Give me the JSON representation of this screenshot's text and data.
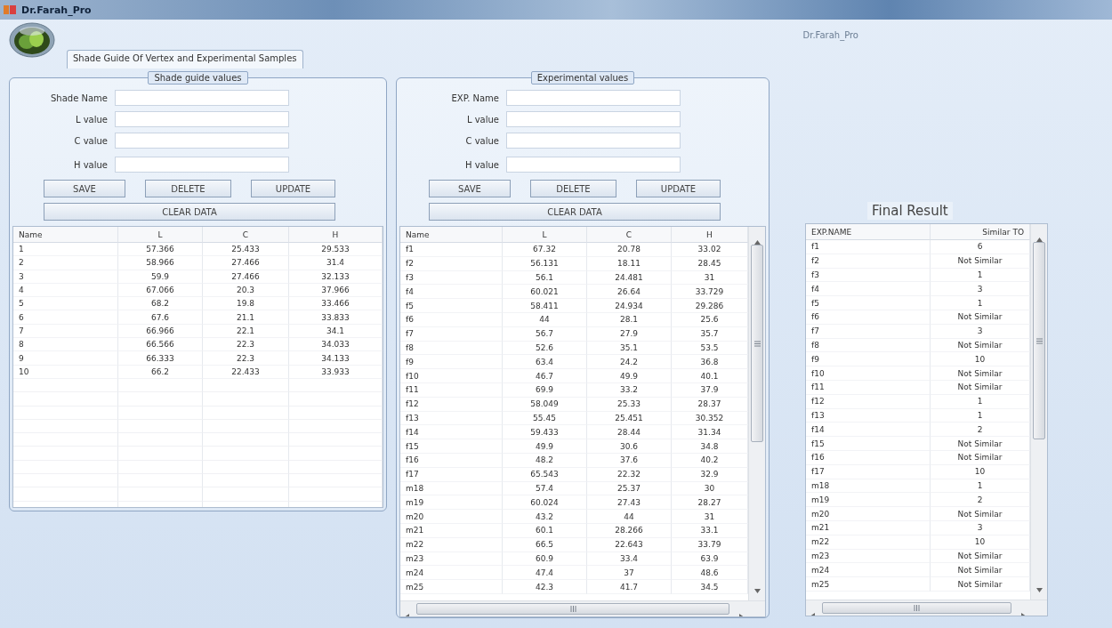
{
  "window": {
    "title": "Dr.Farah_Pro"
  },
  "header": {
    "caption": "Dr.Farah_Pro"
  },
  "tabs": [
    {
      "label": "Shade Guide Of Vertex and Experimental Samples",
      "selected": true
    }
  ],
  "shade_guide": {
    "legend": "Shade guide values",
    "fields": [
      {
        "label": "Shade Name"
      },
      {
        "label": "L value"
      },
      {
        "label": "C value"
      },
      {
        "label": "H value"
      }
    ],
    "buttons": [
      "SAVE",
      "DELETE",
      "UPDATE"
    ],
    "clear_button": "CLEAR DATA",
    "table": {
      "columns": [
        "Name",
        "L",
        "C",
        "H"
      ],
      "rows": [
        [
          "1",
          "57.366",
          "25.433",
          "29.533"
        ],
        [
          "2",
          "58.966",
          "27.466",
          "31.4"
        ],
        [
          "3",
          "59.9",
          "27.466",
          "32.133"
        ],
        [
          "4",
          "67.066",
          "20.3",
          "37.966"
        ],
        [
          "5",
          "68.2",
          "19.8",
          "33.466"
        ],
        [
          "6",
          "67.6",
          "21.1",
          "33.833"
        ],
        [
          "7",
          "66.966",
          "22.1",
          "34.1"
        ],
        [
          "8",
          "66.566",
          "22.3",
          "34.033"
        ],
        [
          "9",
          "66.333",
          "22.3",
          "34.133"
        ],
        [
          "10",
          "66.2",
          "22.433",
          "33.933"
        ]
      ]
    }
  },
  "experimental": {
    "legend": "Experimental values",
    "fields": [
      {
        "label": "EXP. Name"
      },
      {
        "label": "L value"
      },
      {
        "label": "C value"
      },
      {
        "label": "H value"
      }
    ],
    "buttons": [
      "SAVE",
      "DELETE",
      "UPDATE"
    ],
    "clear_button": "CLEAR DATA",
    "table": {
      "columns": [
        "Name",
        "L",
        "C",
        "H"
      ],
      "rows": [
        [
          "f1",
          "67.32",
          "20.78",
          "33.02"
        ],
        [
          "f2",
          "56.131",
          "18.11",
          "28.45"
        ],
        [
          "f3",
          "56.1",
          "24.481",
          "31"
        ],
        [
          "f4",
          "60.021",
          "26.64",
          "33.729"
        ],
        [
          "f5",
          "58.411",
          "24.934",
          "29.286"
        ],
        [
          "f6",
          "44",
          "28.1",
          "25.6"
        ],
        [
          "f7",
          "56.7",
          "27.9",
          "35.7"
        ],
        [
          "f8",
          "52.6",
          "35.1",
          "53.5"
        ],
        [
          "f9",
          "63.4",
          "24.2",
          "36.8"
        ],
        [
          "f10",
          "46.7",
          "49.9",
          "40.1"
        ],
        [
          "f11",
          "69.9",
          "33.2",
          "37.9"
        ],
        [
          "f12",
          "58.049",
          "25.33",
          "28.37"
        ],
        [
          "f13",
          "55.45",
          "25.451",
          "30.352"
        ],
        [
          "f14",
          "59.433",
          "28.44",
          "31.34"
        ],
        [
          "f15",
          "49.9",
          "30.6",
          "34.8"
        ],
        [
          "f16",
          "48.2",
          "37.6",
          "40.2"
        ],
        [
          "f17",
          "65.543",
          "22.32",
          "32.9"
        ],
        [
          "m18",
          "57.4",
          "25.37",
          "30"
        ],
        [
          "m19",
          "60.024",
          "27.43",
          "28.27"
        ],
        [
          "m20",
          "43.2",
          "44",
          "31"
        ],
        [
          "m21",
          "60.1",
          "28.266",
          "33.1"
        ],
        [
          "m22",
          "66.5",
          "22.643",
          "33.79"
        ],
        [
          "m23",
          "60.9",
          "33.4",
          "63.9"
        ],
        [
          "m24",
          "47.4",
          "37",
          "48.6"
        ],
        [
          "m25",
          "42.3",
          "41.7",
          "34.5"
        ]
      ]
    }
  },
  "final_result": {
    "title": "Final Result",
    "table": {
      "columns": [
        "EXP.NAME",
        "Similar TO"
      ],
      "rows": [
        [
          "f1",
          "6"
        ],
        [
          "f2",
          "Not Similar"
        ],
        [
          "f3",
          "1"
        ],
        [
          "f4",
          "3"
        ],
        [
          "f5",
          "1"
        ],
        [
          "f6",
          "Not Similar"
        ],
        [
          "f7",
          "3"
        ],
        [
          "f8",
          "Not Similar"
        ],
        [
          "f9",
          "10"
        ],
        [
          "f10",
          "Not Similar"
        ],
        [
          "f11",
          "Not Similar"
        ],
        [
          "f12",
          "1"
        ],
        [
          "f13",
          "1"
        ],
        [
          "f14",
          "2"
        ],
        [
          "f15",
          "Not Similar"
        ],
        [
          "f16",
          "Not Similar"
        ],
        [
          "f17",
          "10"
        ],
        [
          "m18",
          "1"
        ],
        [
          "m19",
          "2"
        ],
        [
          "m20",
          "Not Similar"
        ],
        [
          "m21",
          "3"
        ],
        [
          "m22",
          "10"
        ],
        [
          "m23",
          "Not Similar"
        ],
        [
          "m24",
          "Not Similar"
        ],
        [
          "m25",
          "Not Similar"
        ]
      ]
    }
  }
}
